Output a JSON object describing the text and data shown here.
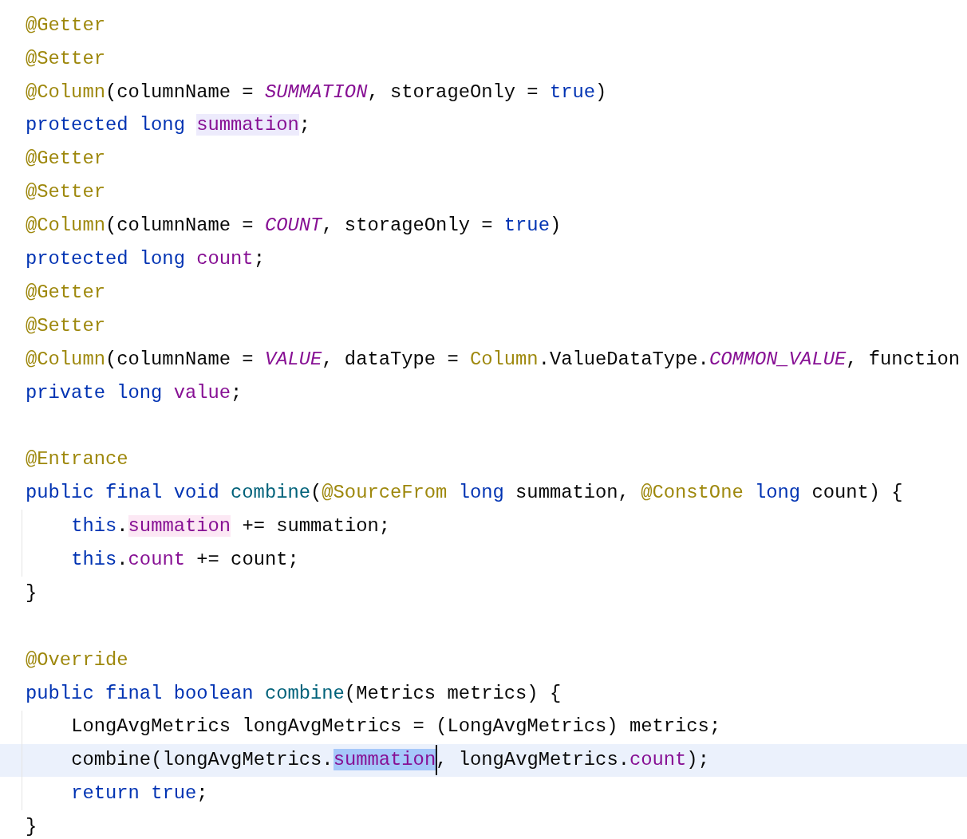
{
  "editor": {
    "lines": [
      {
        "current": false,
        "tokens": [
          {
            "kind": "annotation",
            "text": "@Getter"
          }
        ]
      },
      {
        "current": false,
        "tokens": [
          {
            "kind": "annotation",
            "text": "@Setter"
          }
        ]
      },
      {
        "current": false,
        "tokens": [
          {
            "kind": "annotation",
            "text": "@Column"
          },
          {
            "kind": "plain",
            "text": "(columnName = "
          },
          {
            "kind": "constant",
            "text": "SUMMATION"
          },
          {
            "kind": "plain",
            "text": ", storageOnly = "
          },
          {
            "kind": "keyword",
            "text": "true"
          },
          {
            "kind": "plain",
            "text": ")"
          }
        ]
      },
      {
        "current": false,
        "tokens": [
          {
            "kind": "keyword",
            "text": "protected long "
          },
          {
            "kind": "usage",
            "text": "summation"
          },
          {
            "kind": "plain",
            "text": ";"
          }
        ]
      },
      {
        "current": false,
        "tokens": [
          {
            "kind": "annotation",
            "text": "@Getter"
          }
        ]
      },
      {
        "current": false,
        "tokens": [
          {
            "kind": "annotation",
            "text": "@Setter"
          }
        ]
      },
      {
        "current": false,
        "tokens": [
          {
            "kind": "annotation",
            "text": "@Column"
          },
          {
            "kind": "plain",
            "text": "(columnName = "
          },
          {
            "kind": "constant",
            "text": "COUNT"
          },
          {
            "kind": "plain",
            "text": ", storageOnly = "
          },
          {
            "kind": "keyword",
            "text": "true"
          },
          {
            "kind": "plain",
            "text": ")"
          }
        ]
      },
      {
        "current": false,
        "tokens": [
          {
            "kind": "keyword",
            "text": "protected long "
          },
          {
            "kind": "field",
            "text": "count"
          },
          {
            "kind": "plain",
            "text": ";"
          }
        ]
      },
      {
        "current": false,
        "tokens": [
          {
            "kind": "annotation",
            "text": "@Getter"
          }
        ]
      },
      {
        "current": false,
        "tokens": [
          {
            "kind": "annotation",
            "text": "@Setter"
          }
        ]
      },
      {
        "current": false,
        "tokens": [
          {
            "kind": "annotation",
            "text": "@Column"
          },
          {
            "kind": "plain",
            "text": "(columnName = "
          },
          {
            "kind": "constant",
            "text": "VALUE"
          },
          {
            "kind": "plain",
            "text": ", dataType = "
          },
          {
            "kind": "annotation",
            "text": "Column"
          },
          {
            "kind": "plain",
            "text": ".ValueDataType."
          },
          {
            "kind": "constant",
            "text": "COMMON_VALUE"
          },
          {
            "kind": "plain",
            "text": ", function"
          }
        ]
      },
      {
        "current": false,
        "tokens": [
          {
            "kind": "keyword",
            "text": "private long "
          },
          {
            "kind": "field",
            "text": "value"
          },
          {
            "kind": "plain",
            "text": ";"
          }
        ]
      },
      {
        "current": false
      },
      {
        "current": false,
        "tokens": [
          {
            "kind": "annotation",
            "text": "@Entrance"
          }
        ]
      },
      {
        "current": false,
        "tokens": [
          {
            "kind": "keyword",
            "text": "public final void "
          },
          {
            "kind": "method",
            "text": "combine"
          },
          {
            "kind": "plain",
            "text": "("
          },
          {
            "kind": "annotation",
            "text": "@SourceFrom"
          },
          {
            "kind": "keyword",
            "text": " long "
          },
          {
            "kind": "plain",
            "text": "summation, "
          },
          {
            "kind": "annotation",
            "text": "@ConstOne"
          },
          {
            "kind": "keyword",
            "text": " long "
          },
          {
            "kind": "plain",
            "text": "count) {"
          }
        ],
        "children": [
          {
            "current": false,
            "tokens": [
              {
                "kind": "keyword",
                "text": "this"
              },
              {
                "kind": "plain",
                "text": "."
              },
              {
                "kind": "assignment",
                "text": "summation"
              },
              {
                "kind": "plain",
                "text": " += summation;"
              }
            ]
          },
          {
            "current": false,
            "tokens": [
              {
                "kind": "keyword",
                "text": "this"
              },
              {
                "kind": "plain",
                "text": "."
              },
              {
                "kind": "field",
                "text": "count"
              },
              {
                "kind": "plain",
                "text": " += count;"
              }
            ]
          }
        ]
      },
      {
        "current": false,
        "tokens": [
          {
            "kind": "plain",
            "text": "}"
          }
        ]
      },
      {
        "current": false
      },
      {
        "current": false,
        "tokens": [
          {
            "kind": "annotation",
            "text": "@Override"
          }
        ]
      },
      {
        "current": false,
        "tokens": [
          {
            "kind": "keyword",
            "text": "public final boolean "
          },
          {
            "kind": "method",
            "text": "combine"
          },
          {
            "kind": "plain",
            "text": "(Metrics metrics) {"
          }
        ],
        "children": [
          {
            "current": false,
            "tokens": [
              {
                "kind": "plain",
                "text": "LongAvgMetrics longAvgMetrics = (LongAvgMetrics) metrics;"
              }
            ]
          },
          {
            "current": true,
            "tokens": [
              {
                "kind": "plain",
                "text": "combine(longAvgMetrics."
              },
              {
                "kind": "selection",
                "text": "summation",
                "caret": true
              },
              {
                "kind": "plain",
                "text": ", longAvgMetrics."
              },
              {
                "kind": "field",
                "text": "count"
              },
              {
                "kind": "plain",
                "text": ");"
              }
            ]
          },
          {
            "current": false,
            "tokens": [
              {
                "kind": "keyword",
                "text": "return true"
              },
              {
                "kind": "plain",
                "text": ";"
              }
            ]
          }
        ]
      },
      {
        "current": false,
        "tokens": [
          {
            "kind": "plain",
            "text": "}"
          }
        ]
      }
    ]
  }
}
